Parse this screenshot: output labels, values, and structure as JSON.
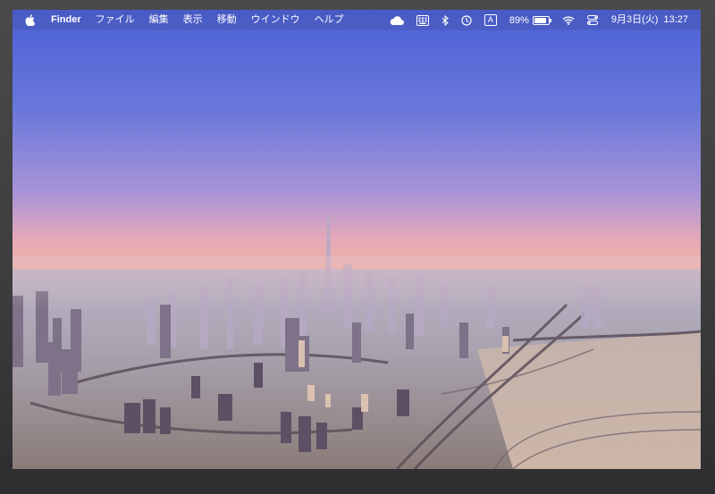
{
  "menubar": {
    "app_name": "Finder",
    "menus": [
      "ファイル",
      "編集",
      "表示",
      "移動",
      "ウインドウ",
      "ヘルプ"
    ],
    "battery_percent": "89%",
    "battery_level": 0.89,
    "input_source": "A",
    "clock": {
      "date": "9月3日(火)",
      "time": "13:27"
    },
    "status_icons": [
      "icloud-icon",
      "keyboard-viewer-icon",
      "bluetooth-icon",
      "time-machine-icon",
      "input-source-icon",
      "battery-icon",
      "wifi-icon",
      "control-center-icon"
    ]
  },
  "desktop": {
    "wallpaper": "aerial-city-skyline-at-dawn",
    "colors": {
      "sky_top": "#4a5fd6",
      "sky_mid": "#a792d6",
      "horizon": "#f2b49a",
      "ground": "#9ea2b2"
    }
  }
}
